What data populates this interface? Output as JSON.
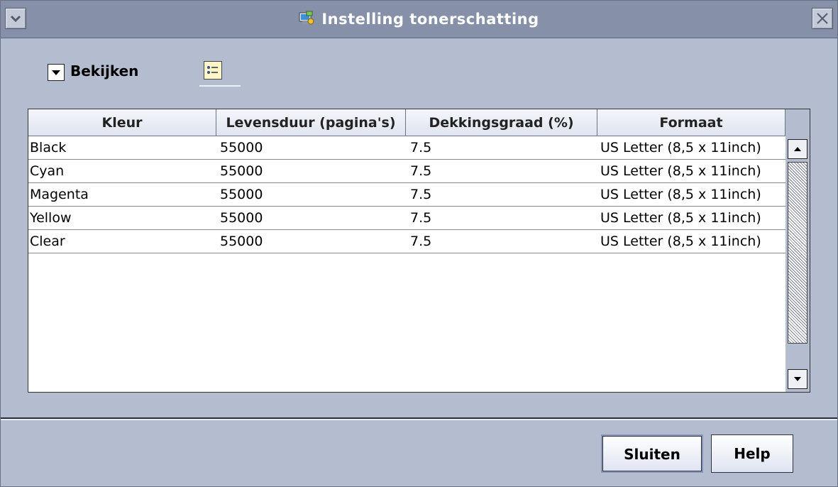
{
  "window": {
    "title": "Instelling tonerschatting",
    "menu_icon": "chevron-down-icon",
    "close_icon": "close-icon",
    "app_icon": "printer-app-icon"
  },
  "toolbar": {
    "view_dropdown_label": "Bekijken",
    "list_view_icon": "list-view-icon"
  },
  "table": {
    "columns": [
      "Kleur",
      "Levensduur (pagina's)",
      "Dekkingsgraad (%)",
      "Formaat"
    ],
    "rows": [
      [
        "Black",
        "55000",
        "7.5",
        "US Letter (8,5 x 11inch)"
      ],
      [
        "Cyan",
        "55000",
        "7.5",
        "US Letter (8,5 x 11inch)"
      ],
      [
        "Magenta",
        "55000",
        "7.5",
        "US Letter (8,5 x 11inch)"
      ],
      [
        "Yellow",
        "55000",
        "7.5",
        "US Letter (8,5 x 11inch)"
      ],
      [
        "Clear",
        "55000",
        "7.5",
        "US Letter (8,5 x 11inch)"
      ]
    ]
  },
  "buttons": {
    "close_label": "Sluiten",
    "help_label": "Help"
  },
  "colors": {
    "titlebar": "#8690a8",
    "background": "#b4bccf"
  }
}
